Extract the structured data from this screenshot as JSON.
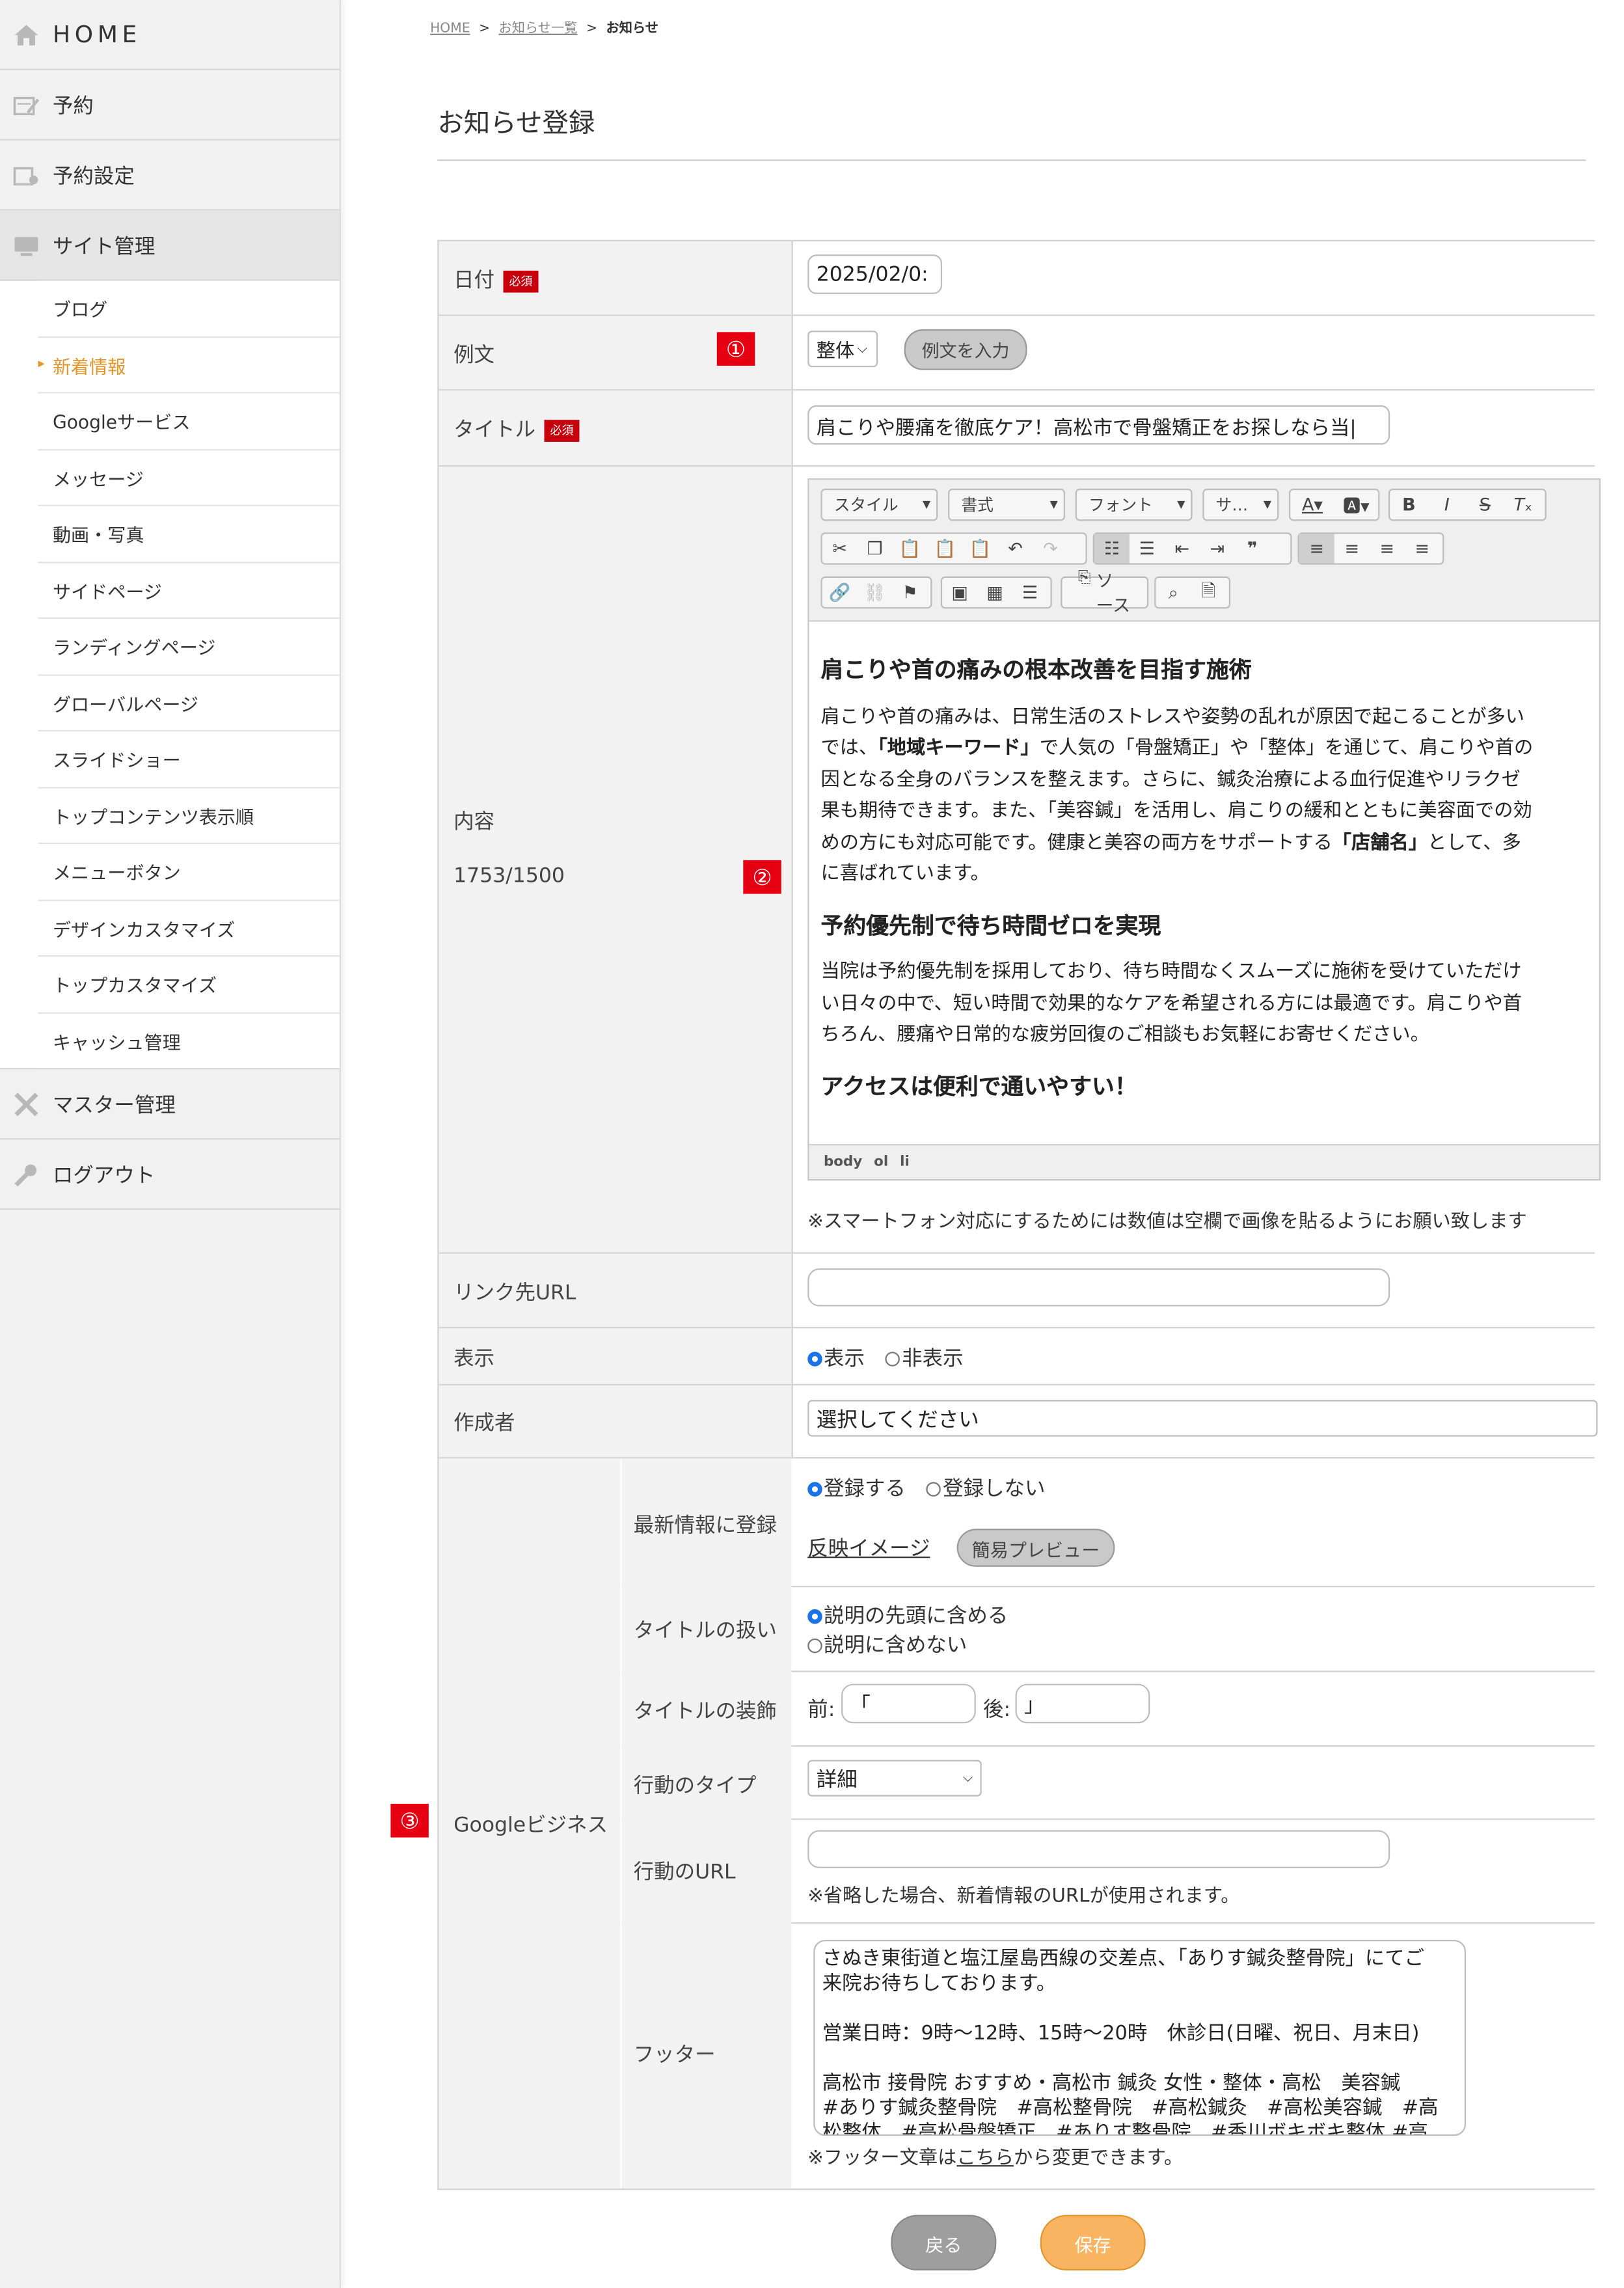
{
  "sidebar": {
    "home": "HOME",
    "reserve": "予約",
    "reserve_settings": "予約設定",
    "site_admin": "サイト管理",
    "sub_items": [
      "ブログ",
      "新着情報",
      "Googleサービス",
      "メッセージ",
      "動画・写真",
      "サイドページ",
      "ランディングページ",
      "グローバルページ",
      "スライドショー",
      "トップコンテンツ表示順",
      "メニューボタン",
      "デザインカスタマイズ",
      "トップカスタマイズ",
      "キャッシュ管理"
    ],
    "master_admin": "マスター管理",
    "logout": "ログアウト"
  },
  "breadcrumb": {
    "home": "HOME",
    "list": "お知らせ一覧",
    "sep": ">",
    "current": "お知らせ"
  },
  "page_title": "お知らせ登録",
  "required_badge": "必須",
  "annotations": [
    "①",
    "②",
    "③"
  ],
  "form": {
    "date": {
      "label": "日付",
      "value": "2025/02/0:"
    },
    "example": {
      "label": "例文",
      "select_value": "整体",
      "button": "例文を入力"
    },
    "title": {
      "label": "タイトル",
      "value": "肩こりや腰痛を徹底ケア！高松市で骨盤矯正をお探しなら当|"
    },
    "content": {
      "label": "内容",
      "count": "1753/1500",
      "toolbar": {
        "style": "スタイル",
        "format": "書式",
        "font": "フォント",
        "size": "サ…",
        "source": "ソース"
      },
      "body": {
        "h1": "肩こりや首の痛みの根本改善を目指す施術",
        "p1": [
          "肩こりや首の痛みは、日常生活のストレスや姿勢の乱れが原因で起こることが多い",
          "では、",
          "「地域キーワード」",
          "で人気の「骨盤矯正」や「整体」を通じて、肩こりや首の",
          "因となる全身のバランスを整えます。さらに、鍼灸治療による血行促進やリラクゼ",
          "果も期待できます。また、「美容鍼」を活用し、肩こりの緩和とともに美容面での効",
          "めの方にも対応可能です。健康と美容の両方をサポートする",
          "「店舗名」",
          "として、多",
          "に喜ばれています。"
        ],
        "h2": "予約優先制で待ち時間ゼロを実現",
        "p2": [
          "当院は予約優先制を採用しており、待ち時間なくスムーズに施術を受けていただけ",
          "い日々の中で、短い時間で効果的なケアを希望される方には最適です。肩こりや首",
          "ちろん、腰痛や日常的な疲労回復のご相談もお気軽にお寄せください。"
        ],
        "h3": "アクセスは便利で通いやすい！"
      },
      "path": [
        "body",
        "ol",
        "li"
      ],
      "note": "※スマートフォン対応にするためには数値は空欄で画像を貼るようにお願い致します"
    },
    "link_url": {
      "label": "リンク先URL",
      "value": ""
    },
    "display": {
      "label": "表示",
      "options": [
        "表示",
        "非表示"
      ],
      "selected": "表示"
    },
    "author": {
      "label": "作成者",
      "value": "選択してください"
    },
    "google": {
      "label": "Googleビジネス",
      "register": {
        "label": "最新情報に登録",
        "options": [
          "登録する",
          "登録しない"
        ],
        "selected": "登録する",
        "preview_link": "反映イメージ",
        "preview_button": "簡易プレビュー"
      },
      "title_handling": {
        "label": "タイトルの扱い",
        "options": [
          "説明の先頭に含める",
          "説明に含めない"
        ],
        "selected": "説明の先頭に含める"
      },
      "title_decoration": {
        "label": "タイトルの装飾",
        "before_label": "前:",
        "before_value": "「",
        "after_label": "後:",
        "after_value": "」"
      },
      "action_type": {
        "label": "行動のタイプ",
        "value": "詳細"
      },
      "action_url": {
        "label": "行動のURL",
        "value": "",
        "note": "※省略した場合、新着情報のURLが使用されます。"
      },
      "footer": {
        "label": "フッター",
        "lines": [
          "さぬき東街道と塩江屋島西線の交差点、「ありす鍼灸整骨院」にてご",
          "来院お待ちしております。",
          "",
          "営業日時：9時〜12時、15時〜20時　休診日(日曜、祝日、月末日)",
          "",
          "高松市 接骨院 おすすめ・高松市 鍼灸 女性・整体・高松　美容鍼",
          "#ありす鍼灸整骨院　#高松整骨院　#高松鍼灸　#高松美容鍼　#高",
          "松整体　#高松骨盤矯正　#ありす整骨院　#香川ボキボキ整体 #高"
        ],
        "note_before": "※フッター文章は",
        "note_link": "こちら",
        "note_after": "から変更できます。"
      }
    }
  },
  "buttons": {
    "back": "戻る",
    "save": "保存"
  },
  "colors": {
    "accent": "#e5942a",
    "required": "#c7000b",
    "annotation": "#e60012",
    "back_button": "#9e9e9e",
    "save_button": "#f8b460"
  }
}
